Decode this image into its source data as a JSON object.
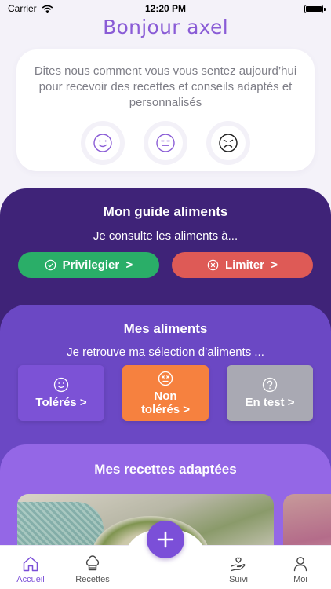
{
  "status_bar": {
    "carrier": "Carrier",
    "time": "12:20 PM"
  },
  "greeting": "Bonjour axel",
  "mood": {
    "prompt": "Dites nous comment vous vous sentez aujourd’hui pour recevoir des recettes et conseils adaptés et personnalisés",
    "options": [
      "happy-face-icon",
      "neutral-face-icon",
      "sad-face-icon"
    ]
  },
  "guide": {
    "title": "Mon guide aliments",
    "subtitle": "Je consulte les aliments à...",
    "privilegier_label": "Privilegier  >",
    "limiter_label": "Limiter  >"
  },
  "aliments": {
    "title": "Mes aliments",
    "subtitle": "Je retrouve ma sélection d’aliments ...",
    "toleres_label": "Tolérés >",
    "non_toleres_label": "Non\ntolérés >",
    "en_test_label": "En test >"
  },
  "recettes": {
    "title": "Mes recettes adaptées"
  },
  "tabs": {
    "accueil": "Accueil",
    "recettes": "Recettes",
    "suivi": "Suivi",
    "moi": "Moi",
    "fab": "+"
  },
  "colors": {
    "accent": "#7b4fd8",
    "guide_bg": "#3f2378",
    "aliments_bg": "#6b48c4",
    "recettes_bg": "#9467e6",
    "green": "#2aae68",
    "red": "#de5a56",
    "orange": "#f6813f",
    "grey": "#a9a9b3"
  }
}
